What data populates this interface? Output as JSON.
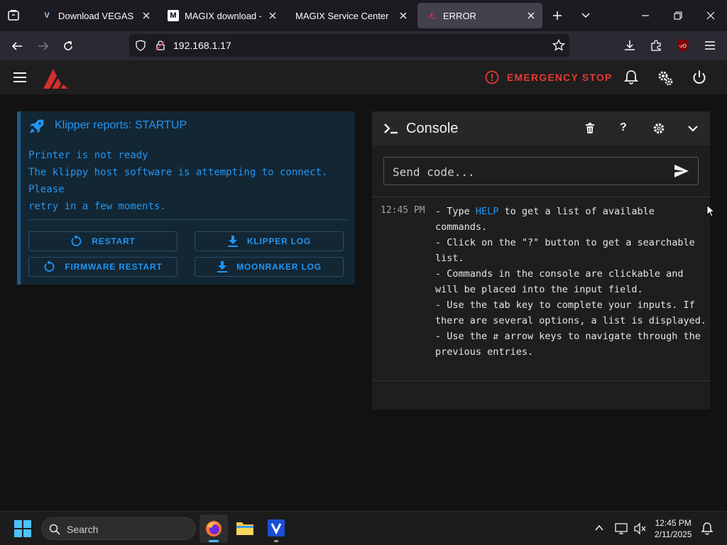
{
  "browser": {
    "tabs": [
      {
        "title": "Download VEGAS Pro T",
        "favicon": "vegas-favicon",
        "active": false
      },
      {
        "title": "MAGIX download - tha",
        "favicon": "magix-favicon",
        "active": false
      },
      {
        "title": "MAGIX Service Center",
        "favicon": "none",
        "active": false
      },
      {
        "title": "ERROR",
        "favicon": "mainsail-favicon",
        "active": true
      }
    ],
    "url": "192.168.1.17"
  },
  "app": {
    "emergency_stop_label": "EMERGENCY STOP",
    "brand_color": "#d32f2f",
    "accent_color": "#2196f3"
  },
  "klipper": {
    "title": "Klipper reports: STARTUP",
    "message": "Printer is not ready\nThe klippy host software is attempting to connect.\nPlease\nretry in a few moments.",
    "buttons": {
      "restart": "RESTART",
      "klipper_log": "KLIPPER LOG",
      "firmware_restart": "FIRMWARE RESTART",
      "moonraker_log": "MOONRAKER LOG"
    }
  },
  "console": {
    "title": "Console",
    "input_placeholder": "Send code...",
    "entries": [
      {
        "time": "12:45 PM",
        "lines": {
          "l1_a": "- Type ",
          "l1_hl": "HELP",
          "l1_b": " to get a list of available commands.",
          "l2": "- Click on the \"?\" button to get a searchable list.",
          "l3": "- Commands in the console are clickable and will be placed into the input field.",
          "l4": "- Use the tab key to complete your inputs. If there are several options, a list is displayed.",
          "l5": "- Use the ⇵ arrow keys to navigate through the previous entries."
        }
      }
    ]
  },
  "taskbar": {
    "search_label": "Search",
    "time": "12:45 PM",
    "date": "2/11/2025"
  }
}
